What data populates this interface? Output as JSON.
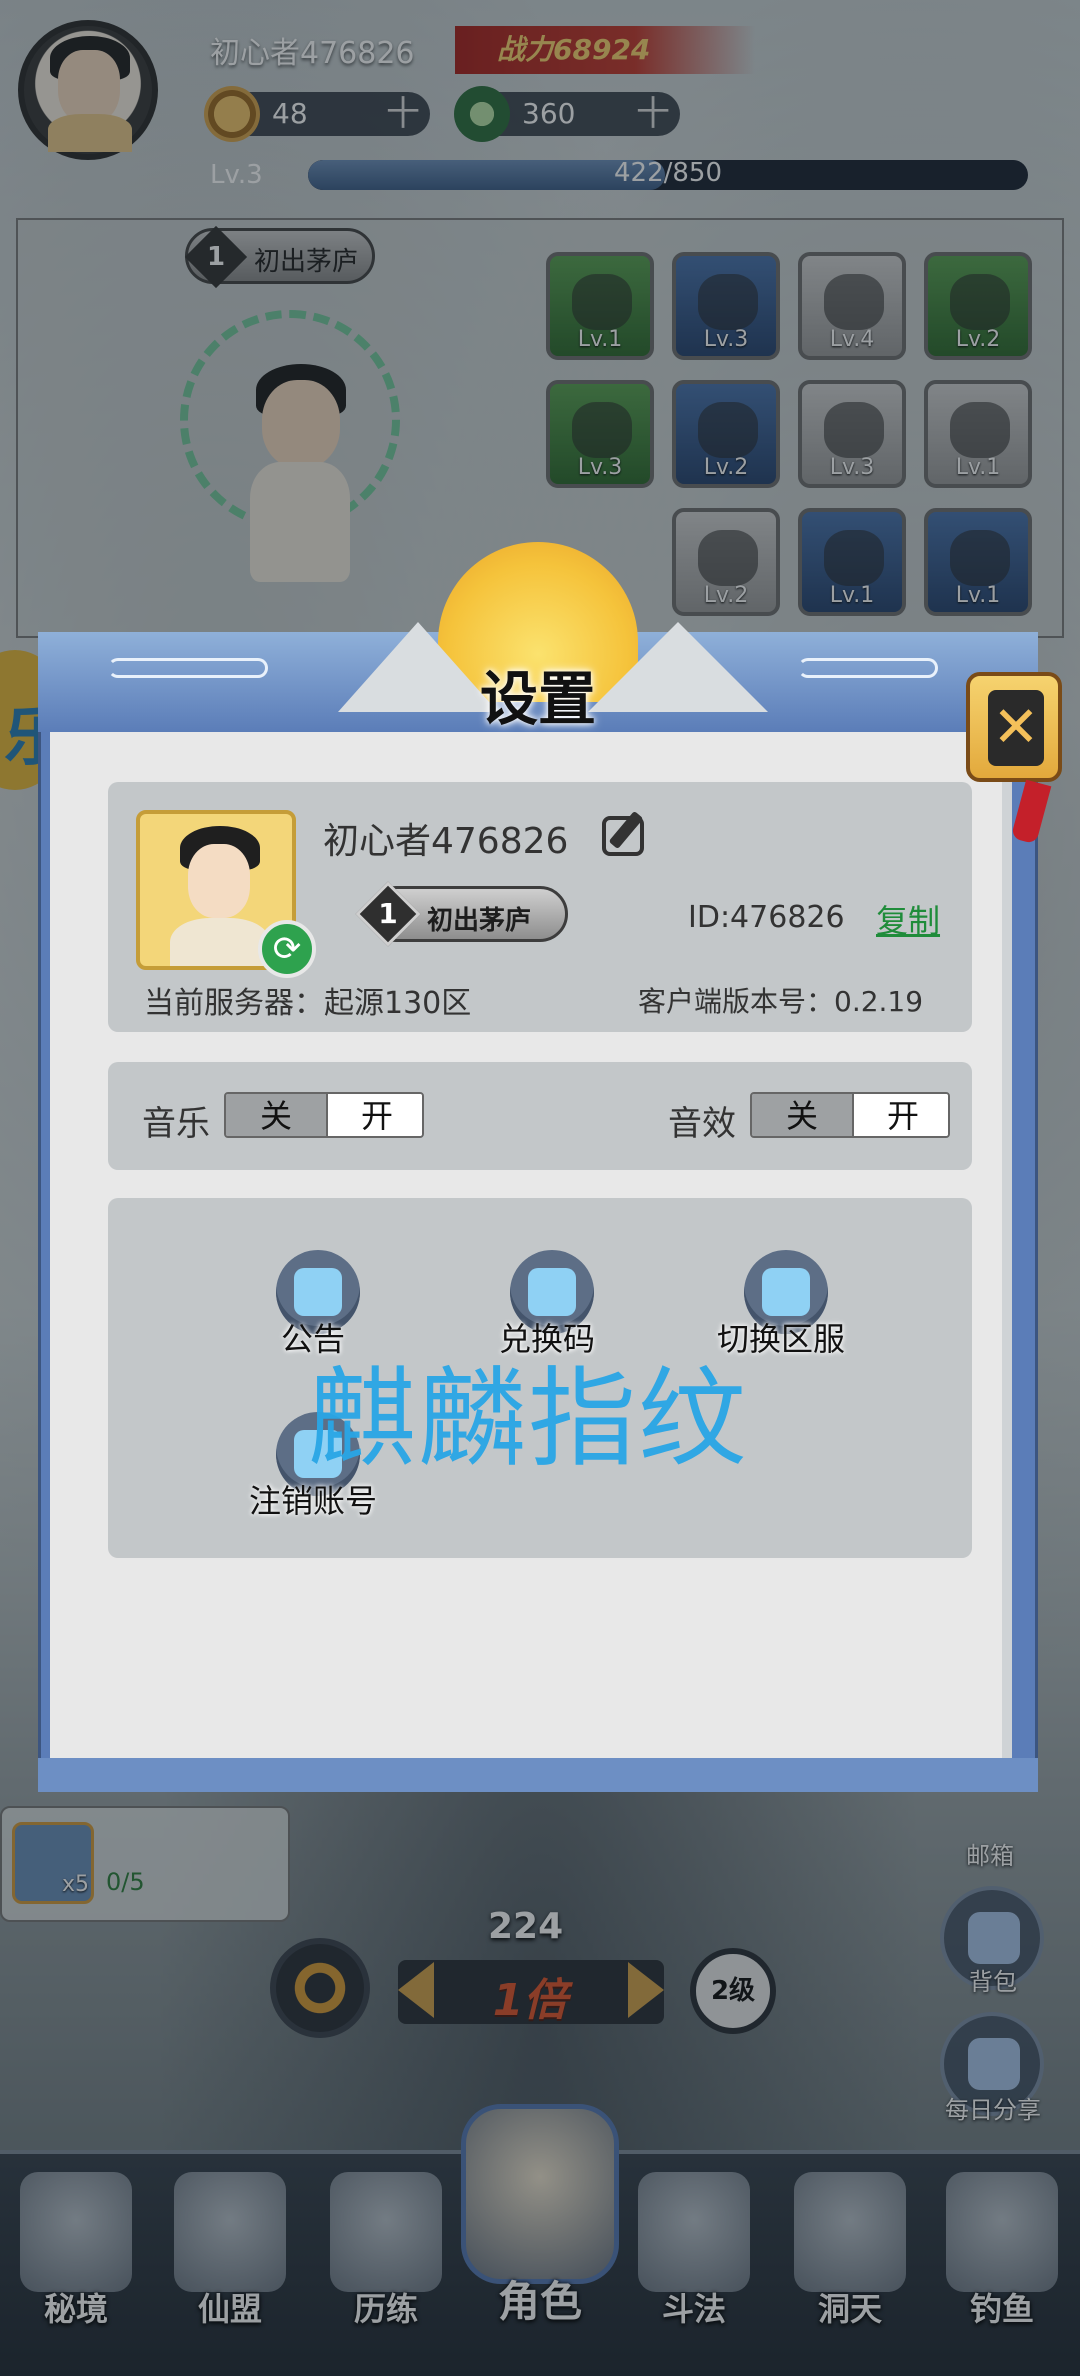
{
  "player": {
    "name": "初心者476826",
    "power": "战力68924",
    "coins": "48",
    "jade": "360",
    "plus": "十",
    "level": "Lv.3",
    "xp": "422/850",
    "xp_fraction": 0.4965,
    "rank_num": "1",
    "rank_title": "初出茅庐"
  },
  "equipment": [
    {
      "level": "Lv.1",
      "color": "green"
    },
    {
      "level": "Lv.3",
      "color": "blue"
    },
    {
      "level": "Lv.4",
      "color": "white"
    },
    {
      "level": "Lv.2",
      "color": "green"
    },
    {
      "level": "Lv.3",
      "color": "green"
    },
    {
      "level": "Lv.2",
      "color": "blue"
    },
    {
      "level": "Lv.3",
      "color": "white"
    },
    {
      "level": "Lv.1",
      "color": "white"
    },
    {
      "level": "Lv.2",
      "color": "white"
    },
    {
      "level": "Lv.1",
      "color": "blue"
    },
    {
      "level": "Lv.1",
      "color": "blue"
    }
  ],
  "side_left_char": "乐",
  "settings": {
    "title": "设置",
    "close_icon": "close-icon",
    "profile": {
      "name": "初心者476826",
      "rank_num": "1",
      "rank_title": "初出茅庐",
      "id": "ID:476826",
      "copy_label": "复制",
      "server": "当前服务器：起源130区",
      "version": "客户端版本号：0.2.19"
    },
    "music": {
      "label": "音乐",
      "off": "关",
      "on": "开"
    },
    "sfx": {
      "label": "音效",
      "off": "关",
      "on": "开"
    },
    "actions": {
      "announcement": "公告",
      "redeem": "兑换码",
      "switch_server": "切换区服",
      "delete_account": "注销账号"
    },
    "watermark": "麒麟指纹"
  },
  "hud": {
    "quest_count": "x5",
    "quest_progress": "0/5",
    "mail": "邮箱",
    "count": "224",
    "speed": "1倍",
    "level_btn": "2级",
    "bag": "背包",
    "share": "每日分享"
  },
  "nav": {
    "secret": "秘境",
    "alliance": "仙盟",
    "trial": "历练",
    "role": "角色",
    "duel": "斗法",
    "cave": "洞天",
    "fishing": "钓鱼"
  }
}
